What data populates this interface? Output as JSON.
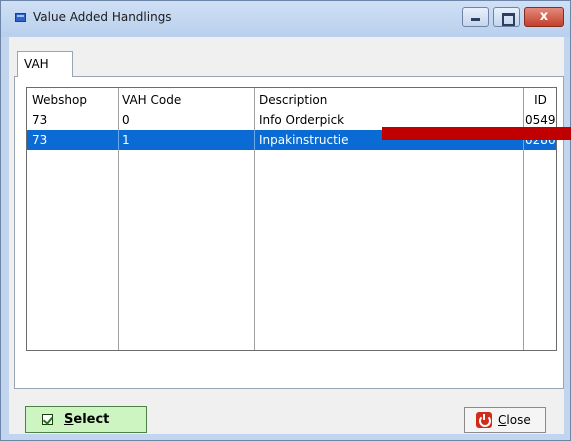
{
  "window": {
    "title": "Value Added Handlings",
    "close_glyph": "x",
    "colors": {
      "selection": "#0a6bd4",
      "select_button": "#ccf5c2",
      "close_button": "#c1402c"
    }
  },
  "tabs": [
    {
      "label": "VAH"
    }
  ],
  "table": {
    "columns": [
      "Webshop",
      "VAH Code",
      "Description",
      "ID"
    ],
    "rows": [
      {
        "webshop": "73",
        "vah_code": "0",
        "description": "Info Orderpick",
        "id": "0549"
      },
      {
        "webshop": "73",
        "vah_code": "1",
        "description": "Inpakinstructie",
        "id": "0286",
        "selected": true
      }
    ]
  },
  "buttons": {
    "select_first": "S",
    "select_rest": "elect",
    "close_first": "C",
    "close_rest": "lose"
  },
  "icons": {
    "app": "app-window-icon",
    "select": "checkbox-icon",
    "close": "power-icon"
  }
}
